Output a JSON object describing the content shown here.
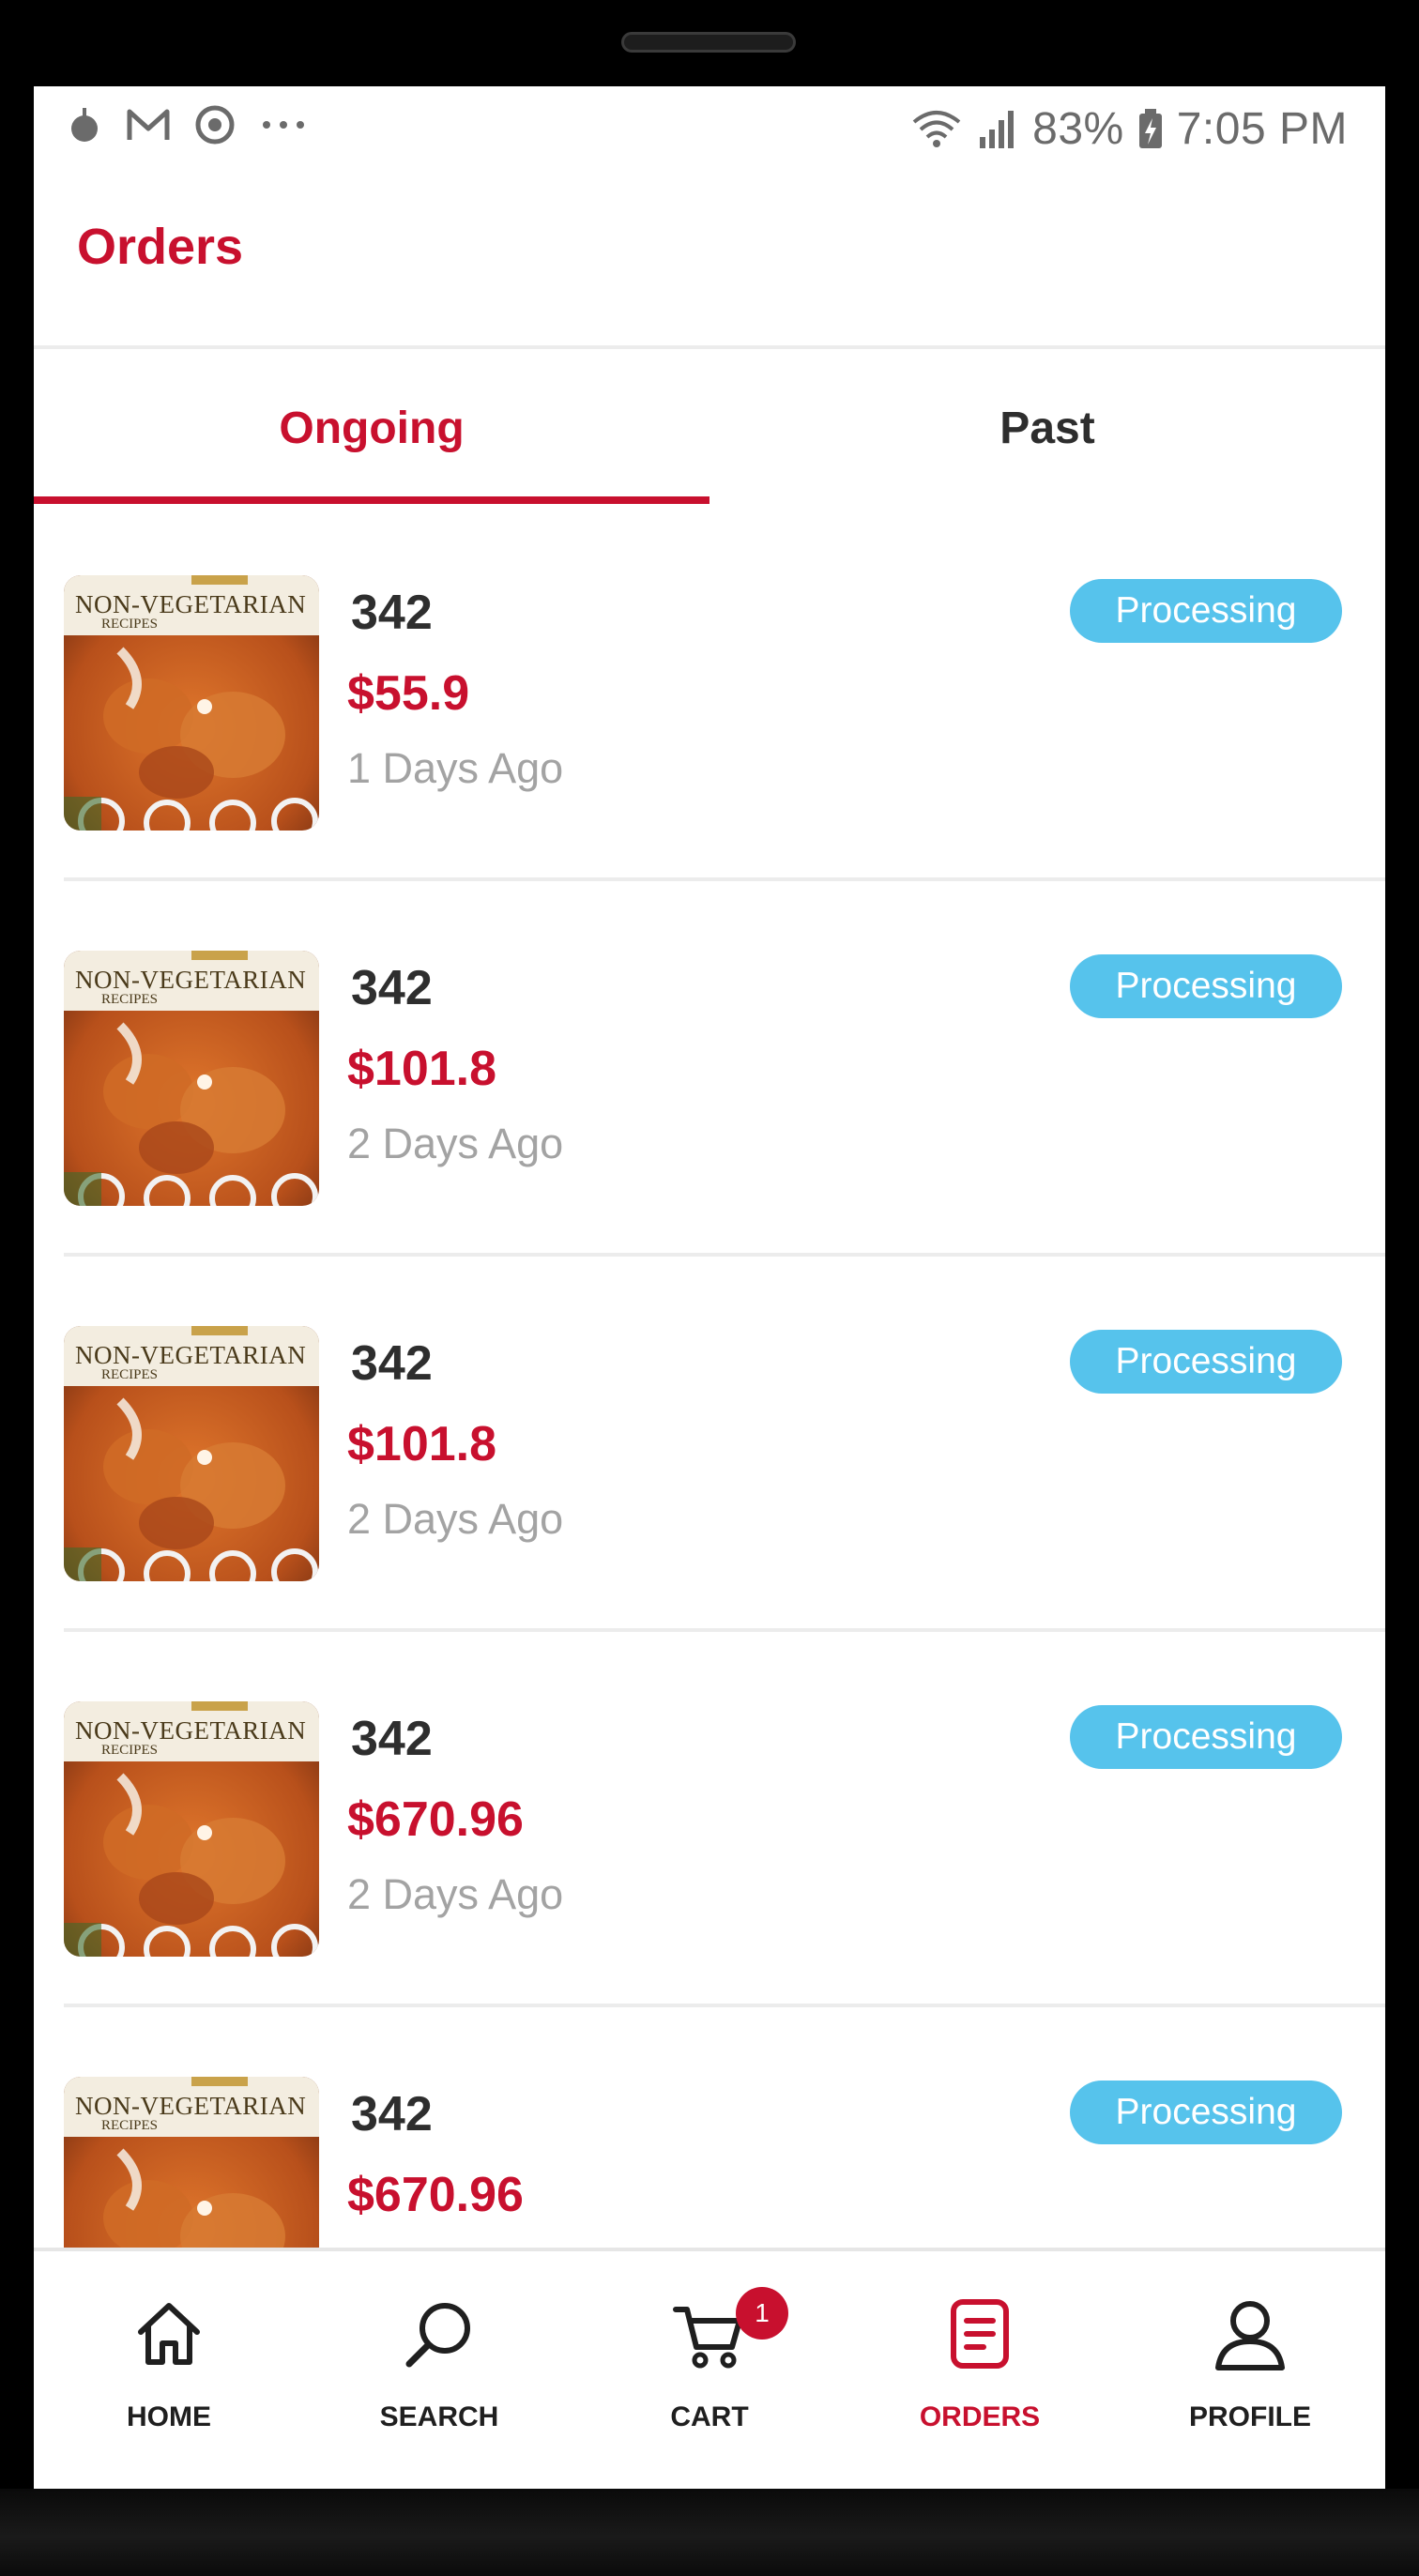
{
  "status_bar": {
    "battery": "83%",
    "time": "7:05 PM"
  },
  "header": {
    "title": "Orders"
  },
  "tabs": [
    {
      "label": "Ongoing",
      "active": true
    },
    {
      "label": "Past",
      "active": false
    }
  ],
  "thumbnail": {
    "title": "NON-VEGETARIAN",
    "subtitle": "RECIPES"
  },
  "orders": [
    {
      "id": "342",
      "price": "$55.9",
      "time_ago": "1 Days Ago",
      "status": "Processing"
    },
    {
      "id": "342",
      "price": "$101.8",
      "time_ago": "2 Days Ago",
      "status": "Processing"
    },
    {
      "id": "342",
      "price": "$101.8",
      "time_ago": "2 Days Ago",
      "status": "Processing"
    },
    {
      "id": "342",
      "price": "$670.96",
      "time_ago": "2 Days Ago",
      "status": "Processing"
    },
    {
      "id": "342",
      "price": "$670.96",
      "time_ago": "",
      "status": "Processing"
    }
  ],
  "bottom_nav": {
    "items": [
      {
        "label": "HOME",
        "icon": "home-icon"
      },
      {
        "label": "SEARCH",
        "icon": "search-icon"
      },
      {
        "label": "CART",
        "icon": "cart-icon"
      },
      {
        "label": "ORDERS",
        "icon": "orders-icon"
      },
      {
        "label": "PROFILE",
        "icon": "profile-icon"
      }
    ],
    "cart_count": "1",
    "active": "ORDERS"
  },
  "colors": {
    "brand": "#c8102e",
    "status_badge": "#56c3ec",
    "muted_text": "#a3a3a3",
    "dark_text": "#2e2e2e"
  }
}
